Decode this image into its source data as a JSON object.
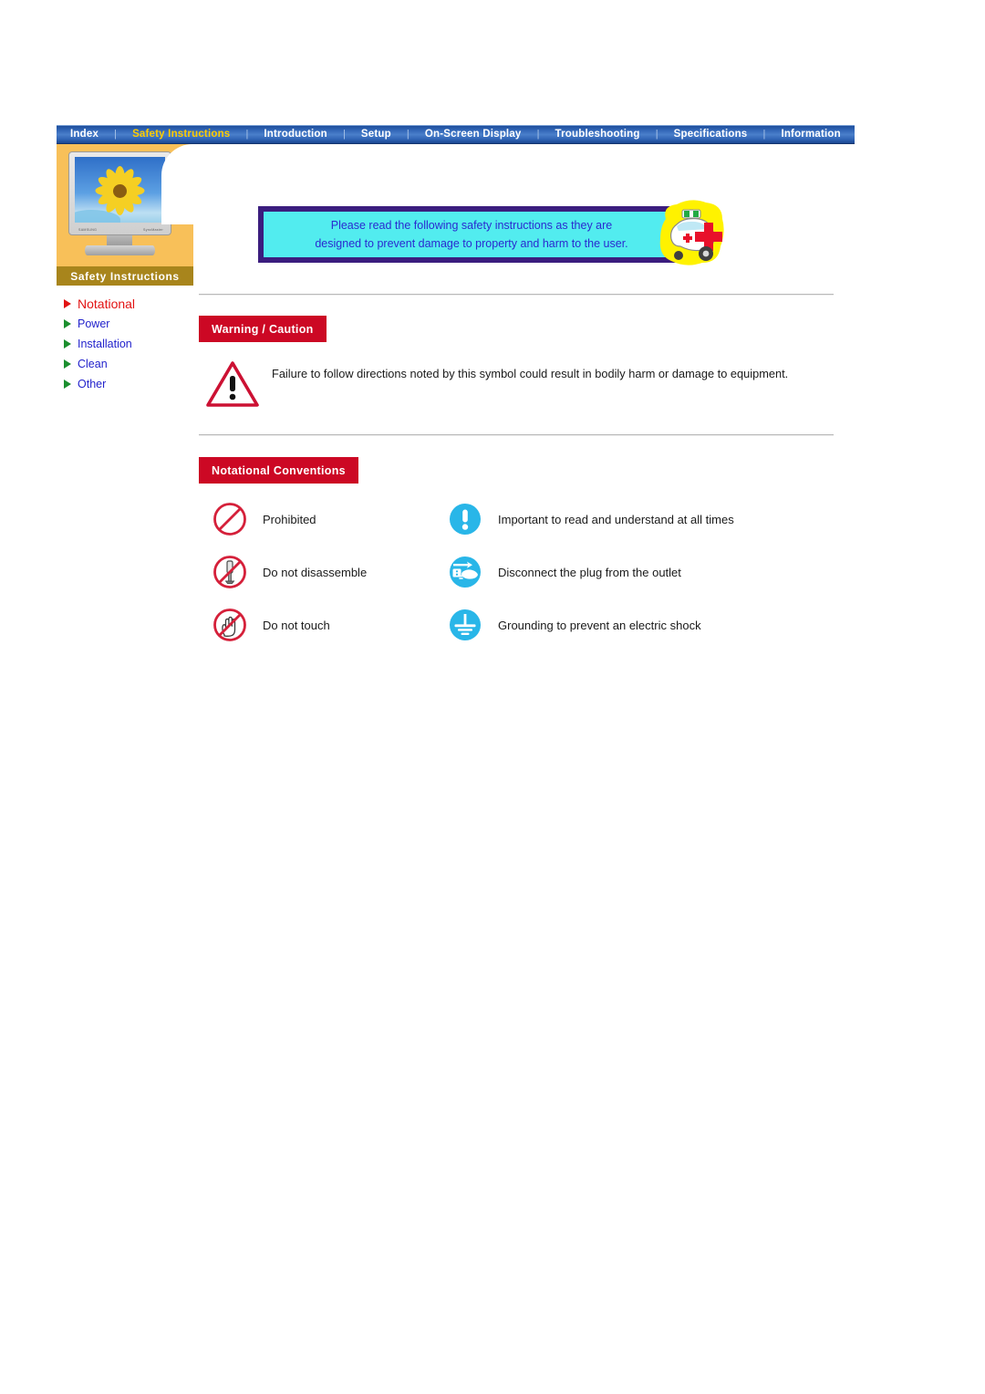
{
  "nav": {
    "separator": "|",
    "items": [
      {
        "label": "Index",
        "active": false
      },
      {
        "label": "Safety Instructions",
        "active": true
      },
      {
        "label": "Introduction",
        "active": false
      },
      {
        "label": "Setup",
        "active": false
      },
      {
        "label": "On-Screen Display",
        "active": false
      },
      {
        "label": "Troubleshooting",
        "active": false
      },
      {
        "label": "Specifications",
        "active": false
      },
      {
        "label": "Information",
        "active": false
      }
    ]
  },
  "sidebar": {
    "caption": "Safety Instructions",
    "thumbnail_brand_left": "SAMSUNG",
    "thumbnail_brand_right": "SyncMaster",
    "items": [
      {
        "label": "Notational",
        "state": "active"
      },
      {
        "label": "Power",
        "state": "normal"
      },
      {
        "label": "Installation",
        "state": "normal"
      },
      {
        "label": "Clean",
        "state": "normal"
      },
      {
        "label": "Other",
        "state": "normal"
      }
    ]
  },
  "banner": {
    "line1": "Please read the following safety instructions as they are",
    "line2": "designed to prevent damage to property and harm to the user.",
    "graphic": "ambulance-icon"
  },
  "warning_section": {
    "heading": "Warning / Caution",
    "icon": "warning-triangle-icon",
    "body": "Failure to follow directions noted by this symbol could result in bodily harm or damage to equipment."
  },
  "notational_section": {
    "heading": "Notational Conventions",
    "rows": [
      {
        "left": {
          "icon": "prohibited-icon",
          "label": "Prohibited"
        },
        "right": {
          "icon": "important-icon",
          "label": "Important to read and understand at all times"
        }
      },
      {
        "left": {
          "icon": "do-not-disassemble-icon",
          "label": "Do not disassemble"
        },
        "right": {
          "icon": "disconnect-plug-icon",
          "label": "Disconnect the plug from the outlet"
        }
      },
      {
        "left": {
          "icon": "do-not-touch-icon",
          "label": "Do not touch"
        },
        "right": {
          "icon": "grounding-icon",
          "label": "Grounding to prevent an electric shock"
        }
      }
    ]
  },
  "colors": {
    "nav_blue": "#2f63b4",
    "nav_active_text": "#ffcc00",
    "sidebar_orange": "#f8c059",
    "sidebar_caption_bg": "#a8851c",
    "heading_red": "#cc0824",
    "banner_border": "#3b1d7e",
    "banner_fill": "#52ecef",
    "banner_text": "#2a2ad0",
    "menu_link": "#2222cc",
    "menu_active": "#e21313",
    "bullet_green": "#1b8f2e",
    "icon_blue": "#29b6e8",
    "icon_red": "#d5203a"
  }
}
